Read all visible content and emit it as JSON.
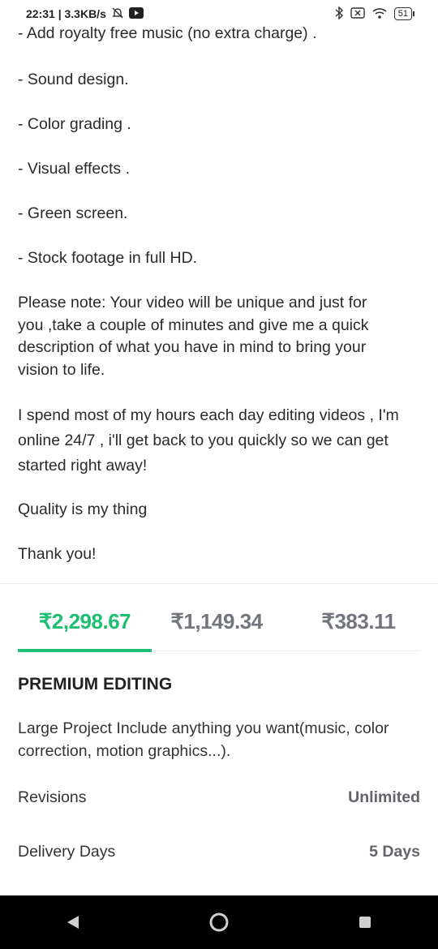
{
  "status_bar": {
    "time_speed": "22:31 | 3.3KB/s",
    "battery": "51"
  },
  "description": {
    "items": [
      "- Add royalty free music (no extra charge) .",
      "- Sound design.",
      "- Color grading .",
      "- Visual effects .",
      "- Green screen.",
      "- Stock footage in full HD."
    ],
    "note": "Please note: Your video will be unique and just for you ,take a couple of minutes and give me a quick description of what you have in mind to bring your vision to life.",
    "spend": "I spend most of my hours each day editing videos , I'm online 24/7 , i'll get back to you quickly so we can get started right away!",
    "quality": "Quality is my thing",
    "thanks": "Thank you!"
  },
  "tabs": [
    {
      "label": "₹2,298.67",
      "active": true
    },
    {
      "label": "₹1,149.34",
      "active": false
    },
    {
      "label": "₹383.11",
      "active": false
    }
  ],
  "package": {
    "title": "PREMIUM EDITING",
    "description": "Large Project Include anything you want(music, color correction, motion graphics...).",
    "revisions_label": "Revisions",
    "revisions_value": "Unlimited",
    "delivery_label": "Delivery Days",
    "delivery_value": "5 Days"
  },
  "colors": {
    "accent": "#1dbf73",
    "inactive_tab": "#74767e"
  }
}
